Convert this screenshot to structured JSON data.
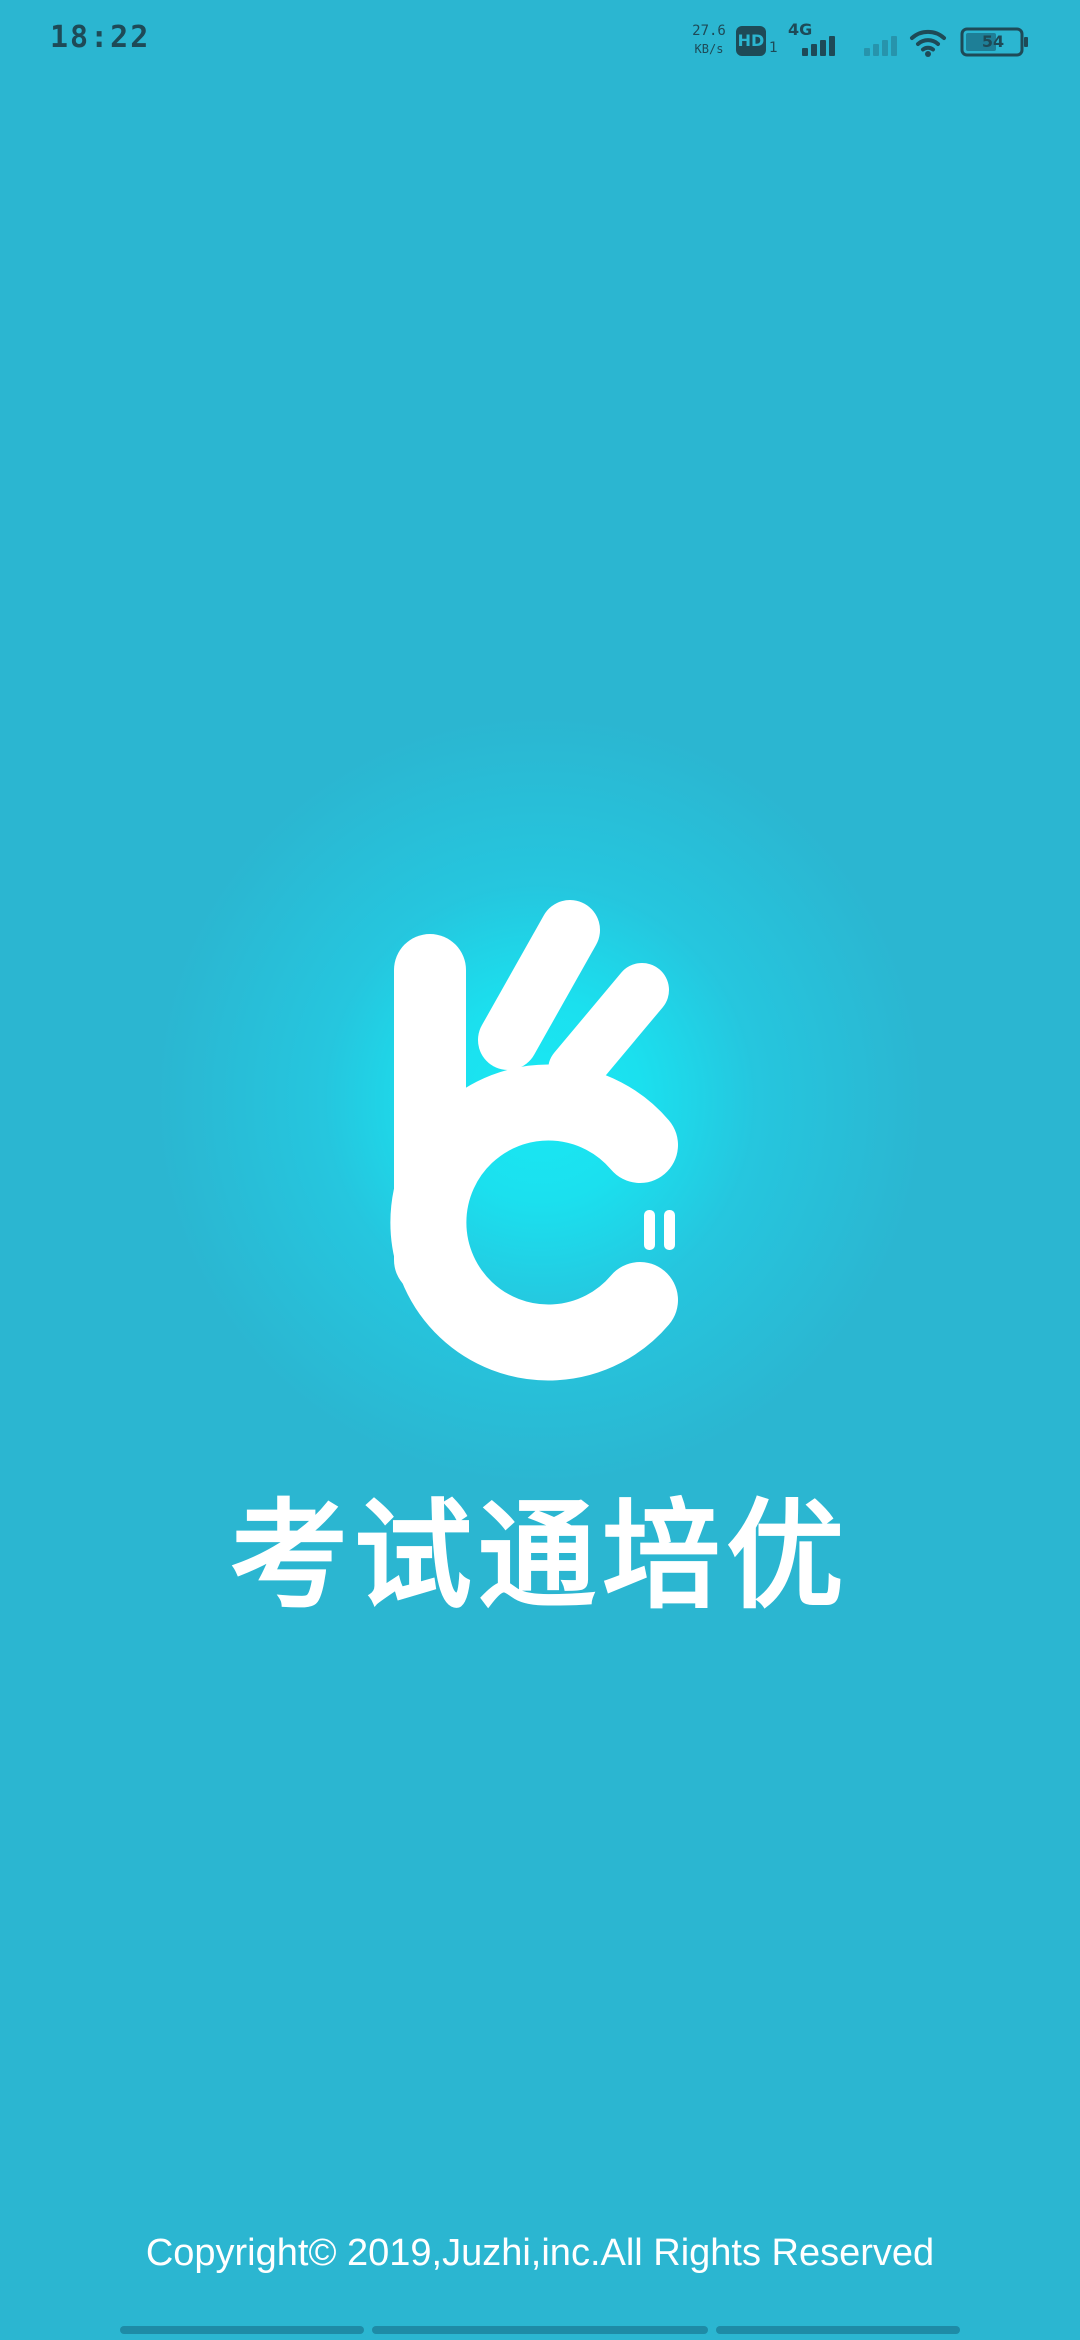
{
  "status_bar": {
    "time": "18:22",
    "net_speed_value": "27.6",
    "net_speed_unit": "KB/s",
    "hd_label": "HD",
    "sim_slot": "1",
    "network_type": "4G",
    "battery_level": "54",
    "icons": [
      "hd-icon",
      "signal-icon",
      "signal-icon",
      "wifi-icon",
      "battery-icon"
    ]
  },
  "splash": {
    "app_name": "考试通培优",
    "logo_icon": "ok-hand-logo-icon",
    "copyright": "Copyright© 2019,Juzhi,inc.All Rights Reserved"
  },
  "colors": {
    "background": "#2BB6D1",
    "glow": "#1AE9F4",
    "foreground": "#FFFFFF",
    "status_text": "#1E4A57"
  }
}
